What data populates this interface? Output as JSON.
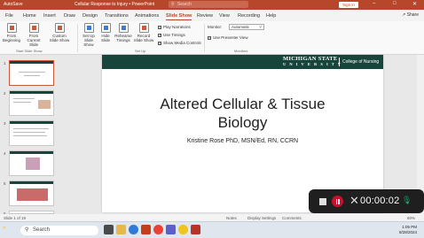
{
  "window": {
    "autosave": "AutoSave",
    "document_title": "Cellular Response to Injury • PowerPoint",
    "search_placeholder": "Search",
    "signin": "Sign in"
  },
  "menu": {
    "tabs": [
      "File",
      "Home",
      "Insert",
      "Draw",
      "Design",
      "Transitions",
      "Animations",
      "Slide Show",
      "Review",
      "View",
      "Recording",
      "Help"
    ],
    "active": "Slide Show",
    "share": "Share"
  },
  "ribbon": {
    "from_beginning": "From Beginning",
    "from_current": "From Current Slide",
    "custom_show": "Custom Slide Show",
    "start_group": "Start Slide Show",
    "setup_show": "Set Up Slide Show",
    "hide_slide": "Hide Slide",
    "rehearse": "Rehearse Timings",
    "record_show": "Record Slide Show",
    "play_narrations": "Play Narrations",
    "use_timings": "Use Timings",
    "show_media": "Show Media Controls",
    "setup_group": "Set Up",
    "monitor_label": "Monitor:",
    "monitor_value": "Automatic",
    "presenter_view": "Use Presenter View",
    "monitors_group": "Monitors"
  },
  "thumbnails": [
    "1",
    "2",
    "3",
    "4",
    "5",
    "6"
  ],
  "slide": {
    "logo_line1": "MICHIGAN STATE",
    "logo_line2": "U N I V E R S I T Y",
    "college": "College of Nursing",
    "title_line1": "Altered Cellular & Tissue",
    "title_line2": "Biology",
    "subtitle": "Kristine Rose PhD, MSN/Ed, RN, CCRN"
  },
  "status": {
    "slide_count": "Slide 1 of 19",
    "notes": "Notes",
    "display": "Display Settings",
    "comments": "Comments",
    "zoom": "60%"
  },
  "recorder": {
    "timer": "00:00:02"
  },
  "taskbar": {
    "search": "Search",
    "time": "1:05 PM",
    "date": "8/28/2024"
  }
}
